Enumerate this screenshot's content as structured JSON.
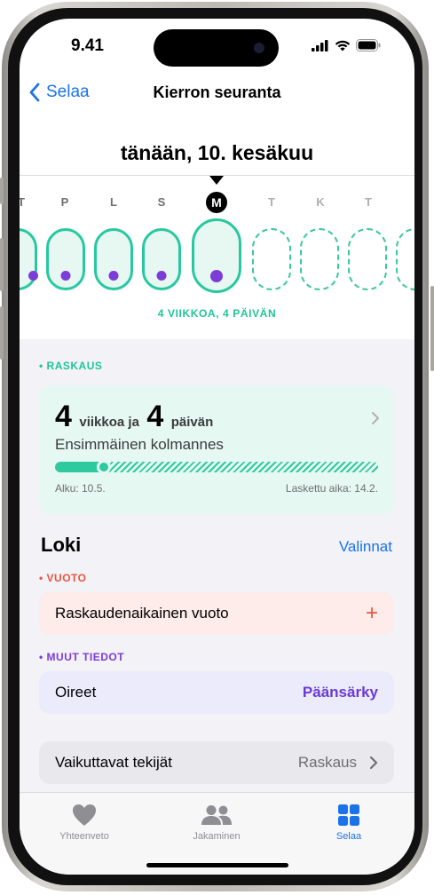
{
  "status": {
    "time": "9.41"
  },
  "nav": {
    "back_label": "Selaa",
    "title": "Kierron seuranta"
  },
  "timeline": {
    "date_title": "tänään, 10. kesäkuu",
    "day_labels": [
      "T",
      "P",
      "L",
      "S",
      "M",
      "T",
      "K",
      "T"
    ],
    "today_label": "M",
    "week_caption": "4 VIIKKOA, 4 PÄIVÄN"
  },
  "pregnancy": {
    "section_label": "• RASKAUS",
    "weeks_num": "4",
    "weeks_word": "viikkoa ja",
    "days_num": "4",
    "days_word": "päivän",
    "trimester": "Ensimmäinen kolmannes",
    "progress_fraction": 0.15,
    "start_label": "Alku: 10.5.",
    "due_label": "Laskettu aika: 14.2."
  },
  "log": {
    "title": "Loki",
    "options_label": "Valinnat",
    "bleeding_section": "• VUOTO",
    "bleeding_row": "Raskaudenaikainen vuoto",
    "bleeding_add": "+",
    "other_section": "• MUUT TIEDOT",
    "symptoms_row": "Oireet",
    "symptoms_value": "Päänsärky",
    "factors_row": "Vaikuttavat tekijät",
    "factors_value": "Raskaus"
  },
  "tabs": [
    {
      "label": "Yhteenveto",
      "icon": "heart-icon"
    },
    {
      "label": "Jakaminen",
      "icon": "people-icon"
    },
    {
      "label": "Selaa",
      "icon": "grid-icon"
    }
  ],
  "colors": {
    "accent": "#1a73e8",
    "teal": "#27c8a0",
    "purple": "#7b3cd8",
    "red": "#e8553c"
  }
}
